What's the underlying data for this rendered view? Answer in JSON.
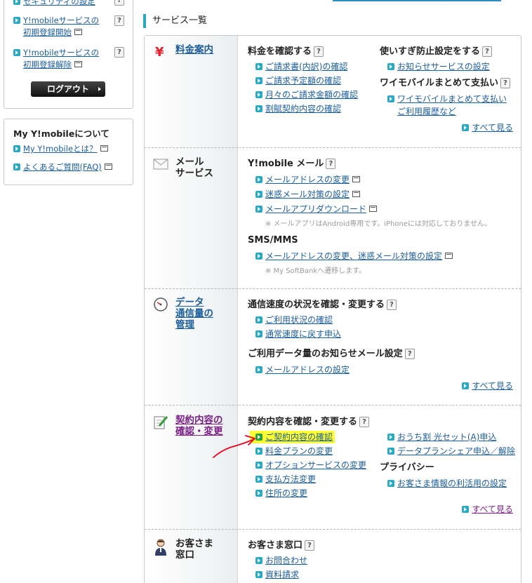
{
  "sidebar": {
    "account_items": [
      {
        "label": "セキュリティの設定"
      },
      {
        "label": "Y!mobileサービスの",
        "label2": "初期登録開始"
      },
      {
        "label": "Y!mobileサービスの",
        "label2": "初期登録解除"
      }
    ],
    "logout_label": "ログアウト",
    "about_title": "My Y!mobileについて",
    "about_items": [
      {
        "label": "My Y!mobileとは？"
      },
      {
        "label": "よくあるご質問(FAQ)"
      }
    ],
    "help_mark": "?"
  },
  "main": {
    "section_title": "サービス一覧",
    "see_all": "すべて見る",
    "categories": [
      {
        "name": "料金案内",
        "icon": "yen-icon",
        "groups": [
          {
            "heading": "料金を確認する",
            "links": [
              "ご請求書(内訳)の確認",
              "ご請求予定額の確認",
              "月々のご請求金額の確認",
              "割賦契約内容の確認"
            ]
          },
          {
            "heading": "使いすぎ防止設定をする",
            "links": [
              "お知らせサービスの設定"
            ]
          },
          {
            "heading": "ワイモバイルまとめて支払い",
            "links": [
              "ワイモバイルまとめて支払い",
              "ご利用履歴など"
            ]
          }
        ]
      },
      {
        "name": "メール",
        "name2": "サービス",
        "icon": "envelope-icon",
        "groups": [
          {
            "heading": "Y!mobile メール",
            "links": [
              "メールアドレスの変更",
              "迷惑メール対策の設定",
              "メールアプリダウンロード"
            ],
            "note": "※ メールアプリはAndroid専用です。iPhoneには対応しておりません。"
          },
          {
            "heading": "SMS/MMS",
            "links": [
              "メールアドレスの変更、迷惑メール対策の設定"
            ],
            "note": "※ My SoftBankへ遷移します。"
          }
        ]
      },
      {
        "name": "データ",
        "name2": "通信量の",
        "name3": "管理",
        "icon": "speedometer-icon",
        "groups": [
          {
            "heading": "通信速度の状況を確認・変更する",
            "links": [
              "ご利用状況の確認",
              "通常速度に戻す申込"
            ]
          },
          {
            "heading": "ご利用データ量のお知らせメール設定",
            "links": [
              "メールアドレスの設定"
            ]
          }
        ]
      },
      {
        "name": "契約内容の",
        "name2": "確認・変更",
        "icon": "memo-pencil-icon",
        "groups": [
          {
            "heading": "契約内容を確認・変更する",
            "links": [
              "ご契約内容の確認",
              "料金プランの変更",
              "オプションサービスの変更",
              "支払方法変更",
              "住所の変更"
            ]
          },
          {
            "heading": "",
            "links": [
              "おうち割 光セット(A)申込",
              "データプランシェア申込／解除"
            ]
          },
          {
            "heading": "プライバシー",
            "links": [
              "お客さま情報の利活用の設定"
            ]
          }
        ]
      },
      {
        "name": "お客さま",
        "name2": "窓口",
        "icon": "operator-icon",
        "groups": [
          {
            "heading": "お客さま窓口",
            "links": [
              "お問合わせ",
              "資料請求"
            ]
          }
        ]
      }
    ]
  },
  "colors": {
    "accent": "#2aa9c4",
    "link": "#1c5e9c",
    "visited": "#7a1f86",
    "highlight": "#ffff33",
    "annotation_arrow": "#e8001c"
  }
}
